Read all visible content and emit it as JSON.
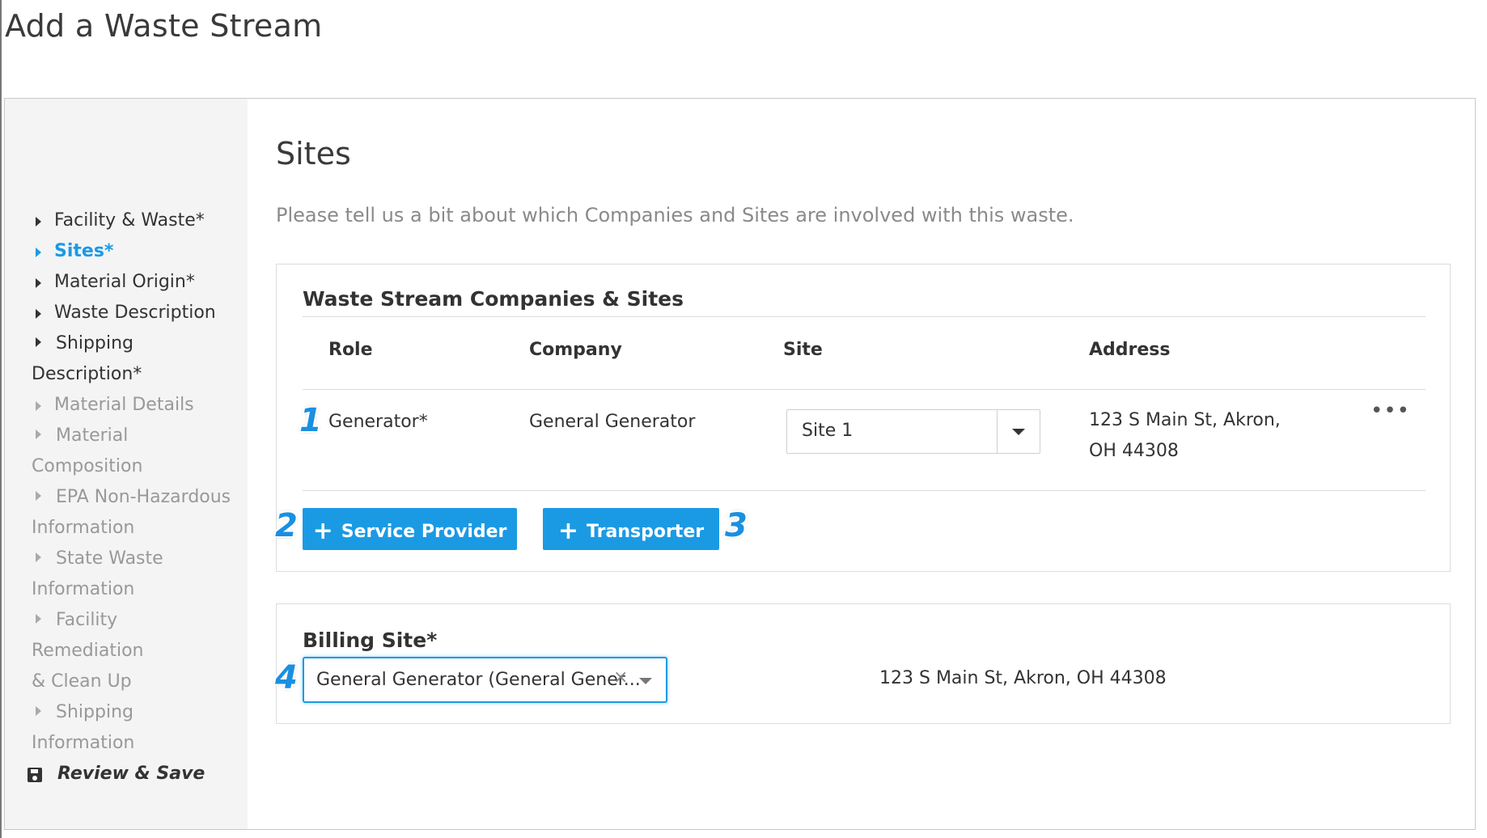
{
  "page": {
    "title": "Add a Waste Stream"
  },
  "sidebar": {
    "items": [
      {
        "label": "Facility & Waste*",
        "state": "default"
      },
      {
        "label": "Sites*",
        "state": "active"
      },
      {
        "label": "Material Origin*",
        "state": "default"
      },
      {
        "label": "Waste Description",
        "state": "default"
      },
      {
        "label": "Shipping",
        "label2": "Description*",
        "state": "default"
      },
      {
        "label": "Material Details",
        "state": "disabled"
      },
      {
        "label": "Material",
        "label2": "Composition",
        "state": "disabled"
      },
      {
        "label": "EPA Non-Hazardous",
        "label2": "Information",
        "state": "disabled"
      },
      {
        "label": "State Waste",
        "label2": "Information",
        "state": "disabled"
      },
      {
        "label": "Facility Remediation",
        "label2": "& Clean Up",
        "state": "disabled"
      },
      {
        "label": "Shipping",
        "label2": "Information",
        "state": "disabled"
      }
    ],
    "review": {
      "label": "Review & Save",
      "icon": "save-icon"
    }
  },
  "main": {
    "title": "Sites",
    "intro": "Please tell us a bit about which Companies and Sites are involved with this waste.",
    "companies": {
      "heading": "Waste Stream Companies & Sites",
      "columns": [
        "Role",
        "Company",
        "Site",
        "Address"
      ],
      "rows": [
        {
          "marker": "1",
          "role": "Generator*",
          "company": "General Generator",
          "site": "Site 1",
          "address": "123 S Main St, Akron, OH 44308",
          "actions_icon": "more-horizontal-icon"
        }
      ],
      "buttons": {
        "service_provider": {
          "plus": "+",
          "label": "Service Provider",
          "marker": "2"
        },
        "transporter": {
          "plus": "+",
          "label": "Transporter",
          "marker": "3"
        }
      }
    },
    "billing": {
      "label": "Billing Site*",
      "marker": "4",
      "selected": "General Generator (General Gener...",
      "clear": "×",
      "address": "123 S Main St, Akron, OH 44308"
    }
  },
  "colors": {
    "accent": "#1b9ae4",
    "marker": "#1b8fe0",
    "sidebar_bg": "#f4f4f4",
    "muted": "#999999"
  }
}
